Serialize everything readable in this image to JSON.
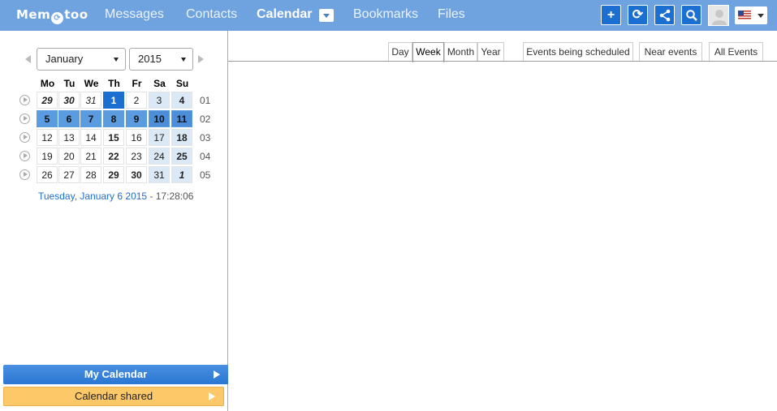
{
  "app": {
    "logo": "Mem",
    "logo_mid": "⟳",
    "logo_end": "too"
  },
  "nav": {
    "messages": "Messages",
    "contacts": "Contacts",
    "calendar": "Calendar",
    "bookmarks": "Bookmarks",
    "files": "Files"
  },
  "toolbar": {
    "add_icon": "+",
    "sync_icon": "⟳",
    "share_icon": "share-icon",
    "search_icon": "search-icon"
  },
  "calendar": {
    "month": "January",
    "year": "2015",
    "dow": [
      "Mo",
      "Tu",
      "We",
      "Th",
      "Fr",
      "Sa",
      "Su"
    ],
    "weeks": [
      {
        "num": "01",
        "days": [
          "29",
          "30",
          "31",
          "1",
          "2",
          "3",
          "4"
        ]
      },
      {
        "num": "02",
        "days": [
          "5",
          "6",
          "7",
          "8",
          "9",
          "10",
          "11"
        ]
      },
      {
        "num": "03",
        "days": [
          "12",
          "13",
          "14",
          "15",
          "16",
          "17",
          "18"
        ]
      },
      {
        "num": "04",
        "days": [
          "19",
          "20",
          "21",
          "22",
          "23",
          "24",
          "25"
        ]
      },
      {
        "num": "05",
        "days": [
          "26",
          "27",
          "28",
          "29",
          "30",
          "31",
          "1"
        ]
      }
    ],
    "date_text": "Tuesday, January 6 2015",
    "time_text": " - 17:28:06"
  },
  "sidebar": {
    "my_calendar": "My Calendar",
    "calendar_shared": "Calendar shared"
  },
  "views": [
    "Day",
    "Week",
    "Month",
    "Year"
  ],
  "filters": [
    "Events being scheduled",
    "Near events",
    "All Events"
  ],
  "colors": {
    "topbar": "#6fa3e0",
    "accent": "#1a6fd0",
    "shared": "#fdc868"
  }
}
